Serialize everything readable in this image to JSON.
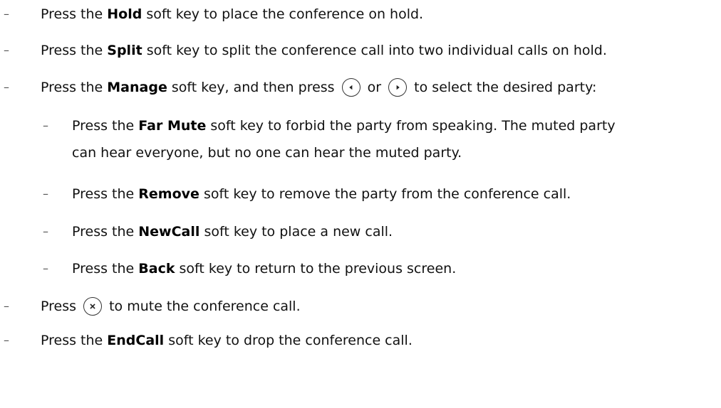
{
  "items": [
    {
      "pre": "Press the ",
      "key": "Hold",
      "post": " soft key to place the conference on hold."
    },
    {
      "pre": "Press the ",
      "key": "Split",
      "post": " soft key to split the conference call into two individual calls on hold."
    },
    {
      "pre": "Press the ",
      "key": "Manage",
      "mid1": " soft key, and then press ",
      "mid2": " or ",
      "post": " to select the desired party:"
    },
    {
      "pre": "Press the ",
      "key": "Far Mute",
      "post": " soft key to forbid the party from speaking. The muted party",
      "line2": "can hear everyone, but no one can hear the muted party."
    },
    {
      "pre": "Press the ",
      "key": "Remove",
      "post": " soft key to remove the party from the conference call."
    },
    {
      "pre": "Press the ",
      "key": "NewCall",
      "post": " soft key to place a new call."
    },
    {
      "pre": "Press the ",
      "key": "Back",
      "post": " soft key to return to the previous screen."
    },
    {
      "pre": "Press ",
      "post": " to mute the conference call."
    },
    {
      "pre": "Press the ",
      "key": "EndCall",
      "post": " soft key to drop the conference call."
    }
  ],
  "bullet": "–",
  "icons": {
    "left": "left-arrow-key-icon",
    "right": "right-arrow-key-icon",
    "mute": "mute-key-icon"
  }
}
